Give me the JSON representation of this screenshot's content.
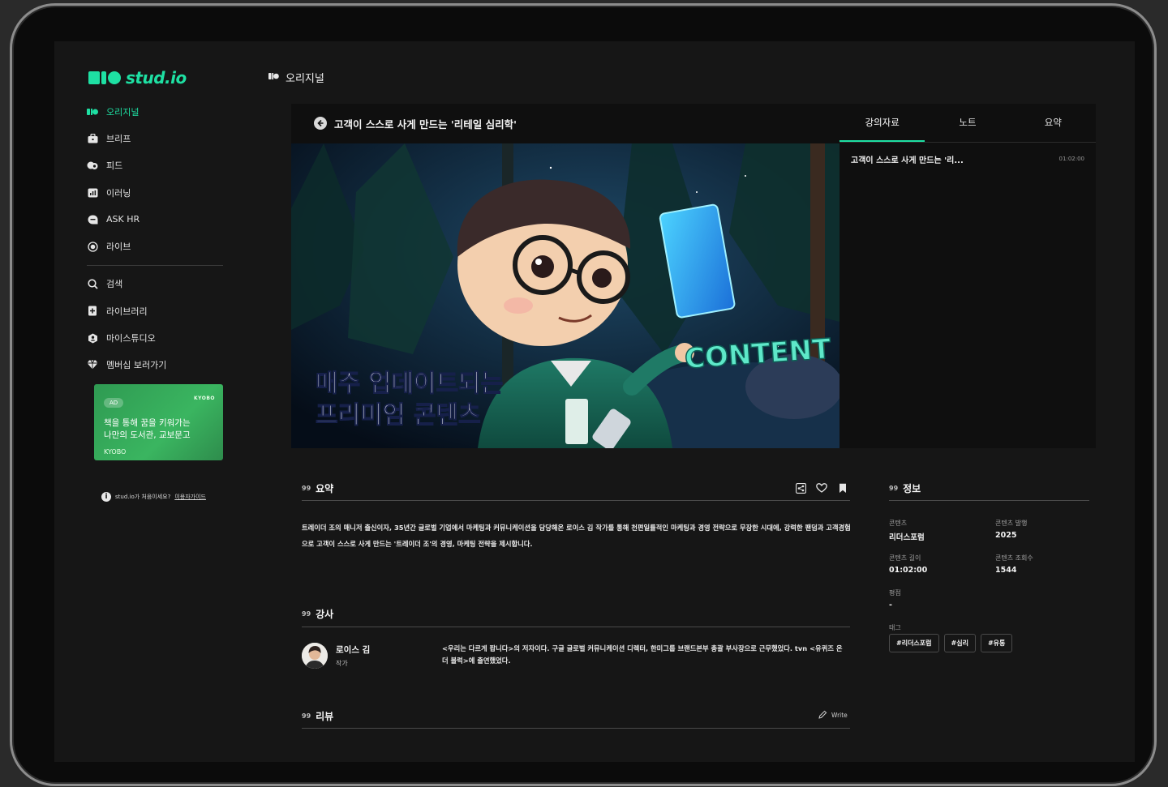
{
  "brand": {
    "logo_text": "stud.io"
  },
  "sidebar": {
    "items": [
      {
        "label": "오리지널",
        "icon": "originals-icon",
        "active": true
      },
      {
        "label": "브리프",
        "icon": "briefcase-icon"
      },
      {
        "label": "피드",
        "icon": "feed-icon"
      },
      {
        "label": "이러닝",
        "icon": "elearning-icon"
      },
      {
        "label": "ASK HR",
        "icon": "chat-icon"
      },
      {
        "label": "라이브",
        "icon": "live-icon"
      }
    ],
    "items2": [
      {
        "label": "검색",
        "icon": "search-icon"
      },
      {
        "label": "라이브러리",
        "icon": "library-icon"
      },
      {
        "label": "마이스튜디오",
        "icon": "my-studio-icon"
      },
      {
        "label": "멤버십 보러가기",
        "icon": "membership-icon"
      }
    ],
    "ad": {
      "badge": "AD",
      "brand": "KYOBO",
      "line1": "책을 통해 꿈을 키워가는",
      "line2": "나만의 도서관, 교보문고",
      "sub": "KYOBO"
    },
    "help_text": "stud.io가 처음이세요?",
    "help_link": "이용자가이드"
  },
  "header": {
    "title": "오리지널"
  },
  "player": {
    "title": "고객이 스스로 사게 만드는 '리테일 심리학'",
    "overlay_line1": "매주 업데이트되는",
    "overlay_line2": "프리미엄 콘텐츠",
    "overlay_word": "CONTENT"
  },
  "tabs": [
    {
      "label": "강의자료",
      "active": true
    },
    {
      "label": "노트"
    },
    {
      "label": "요약"
    }
  ],
  "playlist": [
    {
      "title": "고객이 스스로 사게 만드는 '리...",
      "time": "01:02:00"
    }
  ],
  "summary": {
    "heading": "요약",
    "quote": "99",
    "text": "트레이더 조의 매니저 출신이자, 35년간 글로벌 기업에서 마케팅과 커뮤니케이션을 담당해온 로이스 김 작가를 통해 천편일률적인 마케팅과 경영 전략으로 무장한 시대에, 강력한 팬덤과 고객경험으로 고객이 스스로 사게 만드는 '트레이더 조'의 경영, 마케팅 전략을 제시합니다."
  },
  "instructor": {
    "heading": "강사",
    "quote": "99",
    "name": "로이스 김",
    "role": "작가",
    "bio": "<우리는 다르게 팝니다>의 저자이다. 구글 글로벌 커뮤니케이션 디렉터, 한미그룹 브랜드본부 총괄 부사장으로 근무했었다. tvn <유퀴즈 온 더 블럭>에 출연했었다."
  },
  "review": {
    "heading": "리뷰",
    "quote": "99",
    "write_label": "Write"
  },
  "info": {
    "heading": "정보",
    "quote": "99",
    "fields": [
      {
        "label": "콘텐츠",
        "value": "리더스포럼"
      },
      {
        "label": "콘텐츠 발행",
        "value": "2025"
      },
      {
        "label": "콘텐츠 길이",
        "value": "01:02:00"
      },
      {
        "label": "콘텐츠 조회수",
        "value": "1544"
      },
      {
        "label": "평점",
        "value": "-"
      }
    ],
    "tags_label": "태그",
    "tags": [
      "#리더스포럼",
      "#심리",
      "#유통"
    ]
  },
  "colors": {
    "accent": "#1ee0a3",
    "background": "#161616",
    "ad_green": "#3ab560"
  }
}
